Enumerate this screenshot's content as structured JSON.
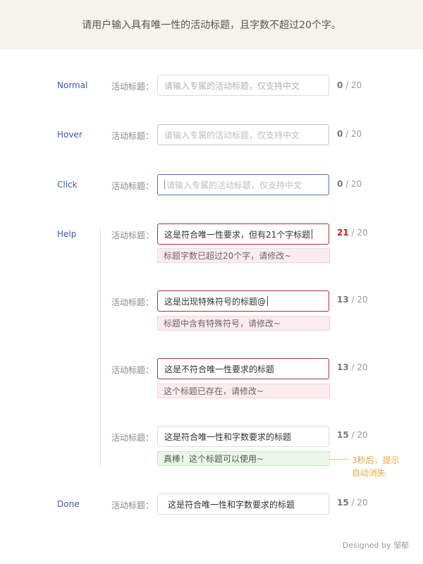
{
  "banner": {
    "text": "请用户输入具有唯一性的活动标题，且字数不超过20个字。"
  },
  "field_label": "活动标题：",
  "max_count": "/ 20",
  "states": {
    "normal": {
      "label": "Normal",
      "placeholder": "请输入专属的活动标题，仅支持中文",
      "count": "0"
    },
    "hover": {
      "label": "Hover",
      "placeholder": "请输入专属的活动标题，仅支持中文",
      "count": "0"
    },
    "click": {
      "label": "Click",
      "placeholder": "请输入专属的活动标题，仅支持中文",
      "count": "0"
    },
    "help": {
      "label": "Help",
      "cases": [
        {
          "value": "这是符合唯一性要求，但有21个字标题",
          "count": "21",
          "message": "标题字数已超过20个字，请修改~"
        },
        {
          "value": "这是出现特殊符号的标题@",
          "count": "13",
          "message": "标题中含有特殊符号，请修改~"
        },
        {
          "value": "这是不符合唯一性要求的标题",
          "count": "13",
          "message": "这个标题已存在，请修改~"
        },
        {
          "value": "这是符合唯一性和字数要求的标题",
          "count": "15",
          "message": "真棒！这个标题可以使用~"
        }
      ],
      "note_line1": "3秒后，提示",
      "note_line2": "自动消失"
    },
    "done": {
      "label": "Done",
      "value": "这是符合唯一性和字数要求的标题",
      "count": "15"
    }
  },
  "footer": "Designed by 邹郁",
  "colors": {
    "banner_bg": "#f5f3ec",
    "state_label": "#3b5bb5",
    "focus_border": "#4a74c9",
    "error_border": "#b03040",
    "error_count": "#c0202a",
    "error_msg_bg": "#fdecef",
    "success_msg_bg": "#eaf7e8",
    "note": "#f2a93b"
  }
}
